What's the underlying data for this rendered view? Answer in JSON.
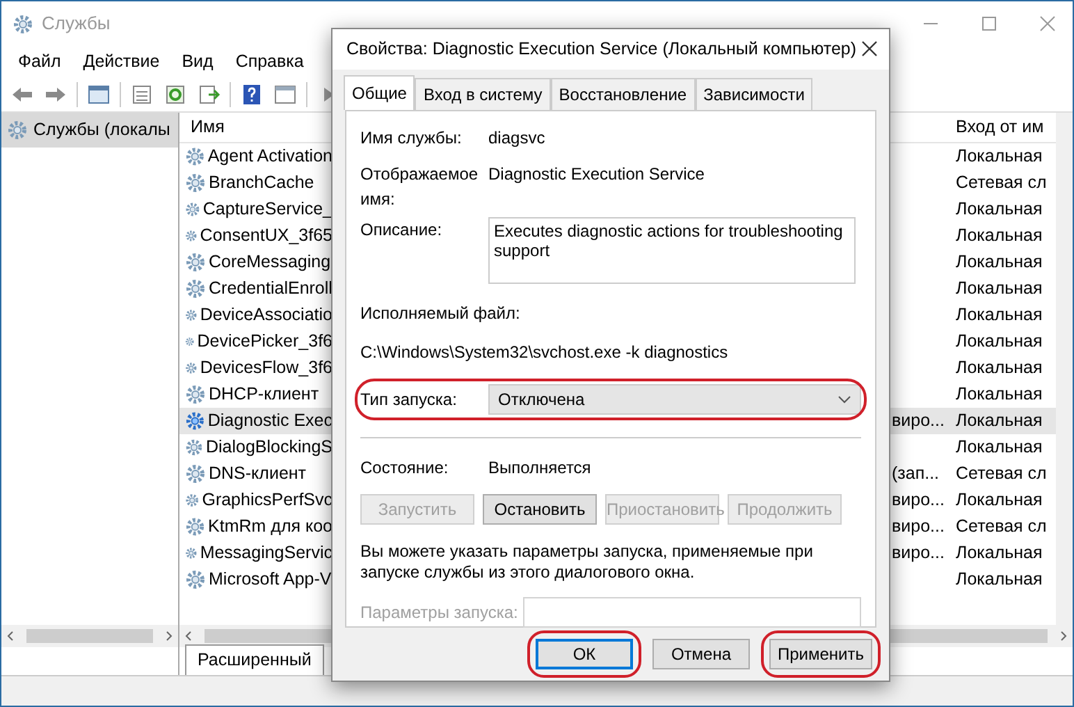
{
  "window": {
    "title": "Службы"
  },
  "menu": [
    "Файл",
    "Действие",
    "Вид",
    "Справка"
  ],
  "tree": {
    "items": [
      {
        "label": "Службы (локалы",
        "selected": true
      }
    ]
  },
  "services": {
    "columns": [
      "Имя",
      "Вход от им"
    ],
    "rows": [
      {
        "name": "Agent Activation",
        "column_2": "",
        "logon": "Локальная",
        "selected": false
      },
      {
        "name": "BranchCache",
        "column_2": "",
        "logon": "Сетевая сл",
        "selected": false
      },
      {
        "name": "CaptureService_",
        "column_2": "",
        "logon": "Локальная",
        "selected": false
      },
      {
        "name": "ConsentUX_3f65",
        "column_2": "",
        "logon": "Локальная",
        "selected": false
      },
      {
        "name": "CoreMessaging",
        "column_2": "",
        "logon": "Локальная",
        "selected": false
      },
      {
        "name": "CredentialEnroll",
        "column_2": "",
        "logon": "Локальная",
        "selected": false
      },
      {
        "name": "DeviceAssociatio",
        "column_2": "",
        "logon": "Локальная",
        "selected": false
      },
      {
        "name": "DevicePicker_3f6",
        "column_2": "",
        "logon": "Локальная",
        "selected": false
      },
      {
        "name": "DevicesFlow_3f6",
        "column_2": "",
        "logon": "Локальная",
        "selected": false
      },
      {
        "name": "DHCP-клиент",
        "column_2": "",
        "logon": "Локальная",
        "selected": false
      },
      {
        "name": "Diagnostic Exec",
        "column_2": "виро...",
        "logon": "Локальная",
        "selected": true
      },
      {
        "name": "DialogBlockingS",
        "column_2": "",
        "logon": "Локальная",
        "selected": false
      },
      {
        "name": "DNS-клиент",
        "column_2": "(зап...",
        "logon": "Сетевая сл",
        "selected": false
      },
      {
        "name": "GraphicsPerfSvc",
        "column_2": "виро...",
        "logon": "Локальная",
        "selected": false
      },
      {
        "name": "KtmRm для коо",
        "column_2": "виро...",
        "logon": "Сетевая сл",
        "selected": false
      },
      {
        "name": "MessagingServic",
        "column_2": "виро...",
        "logon": "Локальная",
        "selected": false
      },
      {
        "name": "Microsoft App-V",
        "column_2": "",
        "logon": "Локальная",
        "selected": false
      }
    ]
  },
  "view_tabs": [
    {
      "label": "Расширенный",
      "selected": true
    }
  ],
  "dialog": {
    "title": "Свойства: Diagnostic Execution Service (Локальный компьютер)",
    "tabs": [
      {
        "label": "Общие",
        "selected": true
      },
      {
        "label": "Вход в систему",
        "selected": false
      },
      {
        "label": "Восстановление",
        "selected": false
      },
      {
        "label": "Зависимости",
        "selected": false
      }
    ],
    "service_name_label": "Имя службы:",
    "service_name": "diagsvc",
    "display_name_label": "Отображаемое имя:",
    "display_name": "Diagnostic Execution Service",
    "description_label": "Описание:",
    "description": "Executes diagnostic actions for troubleshooting support",
    "executable_label": "Исполняемый файл:",
    "executable": "C:\\Windows\\System32\\svchost.exe -k diagnostics",
    "startup_type": {
      "label": "Тип запуска:",
      "value": "Отключена",
      "highlighted": true
    },
    "status_label": "Состояние:",
    "status": "Выполняется",
    "service_buttons": [
      {
        "label": "Запустить",
        "disabled": true
      },
      {
        "label": "Остановить",
        "disabled": false
      },
      {
        "label": "Приостановить",
        "disabled": true
      },
      {
        "label": "Продолжить",
        "disabled": true
      }
    ],
    "hint": "Вы можете указать параметры запуска, применяемые при запуске службы из этого диалогового окна.",
    "parameters": {
      "label": "Параметры запуска:",
      "disabled": true
    },
    "buttons": [
      {
        "label": "ОК",
        "default": true,
        "highlighted": true
      },
      {
        "label": "Отмена",
        "default": false,
        "highlighted": false
      },
      {
        "label": "Применить",
        "default": false,
        "highlighted": true
      }
    ]
  }
}
